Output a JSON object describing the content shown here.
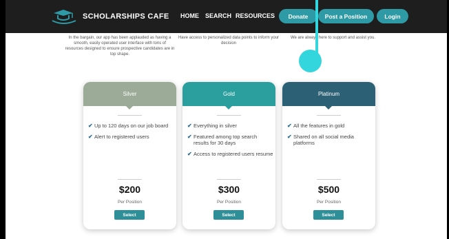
{
  "header": {
    "brand": "SCHOLARSHIPS CAFE",
    "nav_links": [
      "HOME",
      "SEARCH",
      "RESOURCES"
    ],
    "buttons": [
      "Donate",
      "Post a Position",
      "Login"
    ]
  },
  "features": [
    "In the bargain, our app has been applauded as having a smooth, easily operated user interface with tons of resources designed to ensure prospective candidates are in top shape.",
    "Have access to personalized data points to inform your decision",
    "We are always here to support and assist you."
  ],
  "plans": [
    {
      "name": "Silver",
      "items": [
        "Up to 120 days on our job board",
        "Alert to registered users"
      ],
      "price": "$200",
      "per": "Per Position",
      "button": "Select"
    },
    {
      "name": "Gold",
      "items": [
        "Everything in silver",
        "Featured among top search results for 30 days",
        "Access to registered users resume"
      ],
      "price": "$300",
      "per": "Per Position",
      "button": "Select"
    },
    {
      "name": "Platinum",
      "items": [
        "All the features in gold",
        "Shared on all social media platforms"
      ],
      "price": "$500",
      "per": "Per Position",
      "button": "Select"
    }
  ],
  "colors": {
    "accent": "#2e9aa5",
    "silver": "#9bab97",
    "gold": "#2a9f9d",
    "platinum": "#2c6074",
    "marker": "#34d6de"
  }
}
